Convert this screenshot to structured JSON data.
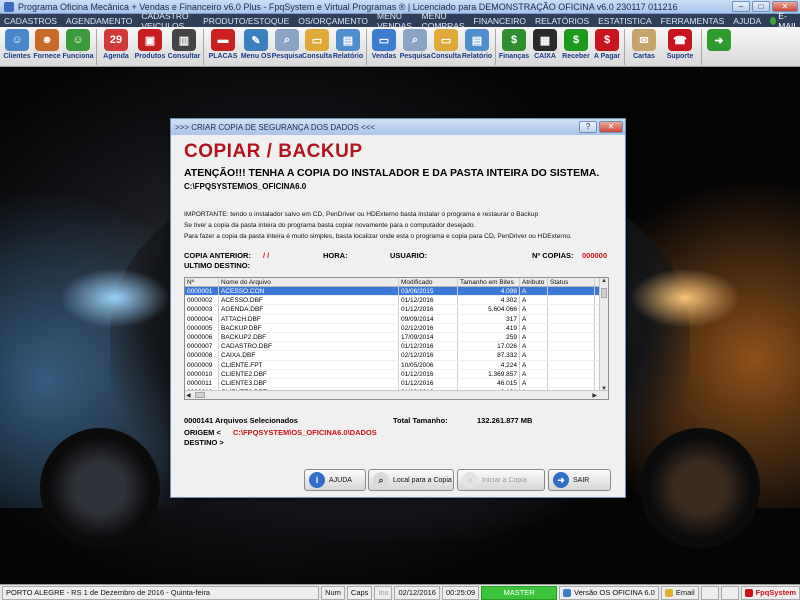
{
  "app": {
    "title": "Programa Oficina Mecânica + Vendas e Financeiro v6.0 Plus - FpqSystem e Virtual Programas ® | Licenciado para  DEMONSTRAÇÃO OFICINA v6.0 230117 011216"
  },
  "menu": [
    "CADASTROS",
    "AGENDAMENTO",
    "CADASTRO VEICULOS",
    "PRODUTO/ESTOQUE",
    "OS/ORÇAMENTO",
    "MENU VENDAS",
    "MENU COMPRAS",
    "FINANCEIRO",
    "RELATÓRIOS",
    "ESTATISTICA",
    "FERRAMENTAS",
    "AJUDA"
  ],
  "menu_email": "E-MAIL",
  "toolbar": [
    {
      "label": "Clientes",
      "icon": "clients-icon",
      "color": "#4a86c8"
    },
    {
      "label": "Fornece",
      "icon": "supplier-icon",
      "color": "#c86a2a"
    },
    {
      "label": "Funciona",
      "icon": "employee-icon",
      "color": "#3b9a3b"
    },
    {
      "label": "Agenda",
      "icon": "calendar-icon",
      "color": "#d23a3a"
    },
    {
      "label": "Produtos",
      "icon": "products-icon",
      "color": "#c41e1e"
    },
    {
      "label": "Consultar",
      "icon": "barcode-icon",
      "color": "#444444"
    },
    {
      "label": "PLACAS",
      "icon": "car-icon",
      "color": "#cc1f1f"
    },
    {
      "label": "Menu OS",
      "icon": "clipboard-icon",
      "color": "#3c7fbf"
    },
    {
      "label": "Pesquisa",
      "icon": "search-doc-icon",
      "color": "#8aa4c8"
    },
    {
      "label": "Consulta",
      "icon": "folder-icon",
      "color": "#e0a93a"
    },
    {
      "label": "Relatório",
      "icon": "report-icon",
      "color": "#4f8fd0"
    },
    {
      "label": "Vendas",
      "icon": "monitor-icon",
      "color": "#3d7ccc"
    },
    {
      "label": "Pesquisa",
      "icon": "search-doc-icon",
      "color": "#8aa4c8"
    },
    {
      "label": "Consulta",
      "icon": "folder-icon",
      "color": "#e0a93a"
    },
    {
      "label": "Relatório",
      "icon": "report-icon",
      "color": "#4f8fd0"
    },
    {
      "label": "Finanças",
      "icon": "finance-icon",
      "color": "#2f8f2f"
    },
    {
      "label": "CAIXA",
      "icon": "cashbox-icon",
      "color": "#2a2a2a"
    },
    {
      "label": "Receber",
      "icon": "receive-money-icon",
      "color": "#1d9a1d"
    },
    {
      "label": "A Pagar",
      "icon": "pay-money-icon",
      "color": "#c8141c"
    },
    {
      "label": "Cartas",
      "icon": "letters-icon",
      "color": "#c8a46a"
    },
    {
      "label": "Suporte",
      "icon": "support-icon",
      "color": "#c8141c"
    },
    {
      "label": "",
      "icon": "exit-icon",
      "color": "#2f9a2f"
    }
  ],
  "dialog": {
    "title": ">>> CRIAR COPIA DE SEGURANÇA DOS DADOS <<<",
    "heading": "COPIAR / BACKUP",
    "warning": "ATENÇÃO!!!  TENHA A COPIA DO  INSTALADOR  E  DA PASTA INTEIRA DO  SISTEMA.",
    "system_path": "C:\\FPQSYSTEM\\OS_OFICINA6.0",
    "info_lines": [
      "IMPORTANTE: tendo o instalador salvo em CD, PenDriver ou HDExterno basta instalar o programa e restaurar o Backup",
      "Se tiver a copia da pasta inteira do programa basta copiar novamente para o computador desejado.",
      "Para fazer a copia da pasta inteira é muito simples, basta localizar onde esta o programa e copia para CD, PenDriver ou HDExterno."
    ],
    "copia_anterior_label": "COPIA ANTERIOR:",
    "copia_anterior_value": "/  /",
    "hora_label": "HORA:",
    "usuario_label": "USUARIO:",
    "n_copias_label": "Nº COPIAS:",
    "n_copias_value": "000000",
    "ultimo_destino_label": "ULTIMO DESTINO:",
    "table": {
      "headers": [
        "Nº",
        "Nome do Arquivo",
        "Modificado",
        "Tamanho em Bites",
        "Atributo",
        "Status"
      ],
      "rows": [
        [
          "0000001",
          "ACESSO.CON",
          "03/06/2015",
          "4.098",
          "A",
          ""
        ],
        [
          "0000002",
          "ACESSO.DBF",
          "01/12/2016",
          "4.302",
          "A",
          ""
        ],
        [
          "0000003",
          "AGENDA.DBF",
          "01/12/2016",
          "5.604.066",
          "A",
          ""
        ],
        [
          "0000004",
          "ATTACH.DBF",
          "09/09/2014",
          "317",
          "A",
          ""
        ],
        [
          "0000005",
          "BACKUP.DBF",
          "02/12/2016",
          "419",
          "A",
          ""
        ],
        [
          "0000006",
          "BACKUP2.DBF",
          "17/09/2014",
          "259",
          "A",
          ""
        ],
        [
          "0000007",
          "CADASTRO.DBF",
          "01/12/2016",
          "17.026",
          "A",
          ""
        ],
        [
          "0000008",
          "CAIXA.DBF",
          "02/12/2016",
          "87.332",
          "A",
          ""
        ],
        [
          "0000009",
          "CLIENTE.FPT",
          "10/05/2006",
          "4.224",
          "A",
          ""
        ],
        [
          "0000010",
          "CLIENTE2.DBF",
          "01/12/2016",
          "1.369.857",
          "A",
          ""
        ],
        [
          "0000011",
          "CLIENTE3.DBF",
          "01/12/2016",
          "46.015",
          "A",
          ""
        ],
        [
          "0000012",
          "CLIENTE3.DBT",
          "01/12/2016",
          "8.101",
          "A",
          ""
        ],
        [
          "0000013",
          "CLIENTES.BAK",
          "01/12/2016",
          "4.517.509",
          "A",
          ""
        ]
      ]
    },
    "selected_count": "0000141 Arquivos Selecionados",
    "total_label": "Total Tamanho:",
    "total_value": "132.261.877 MB",
    "origem_label": "ORIGEM  <",
    "origem_value": "C:\\FPQSYSTEM\\OS_OFICINA6.0\\DADOS",
    "destino_label": "DESTINO >",
    "buttons": {
      "ajuda": "AJUDA",
      "local": "Local para a Copia",
      "iniciar": "Iniciar a Copia",
      "sair": "SAIR"
    },
    "footer": "Qualquer dúvida acesse o nosso Suporte OnLine para receber toda a orientação."
  },
  "status": {
    "city_date": "PORTO ALEGRE - RS   1 de Dezembro de 2016 - Quinta-feira",
    "num": "Num",
    "caps": "Caps",
    "ins": "Ins",
    "date": "02/12/2016",
    "time": "00:25:09",
    "master": "MASTER",
    "version": "Versão OS OFICINA 6.0",
    "email": "Email",
    "fpq": "FpqSystem"
  }
}
